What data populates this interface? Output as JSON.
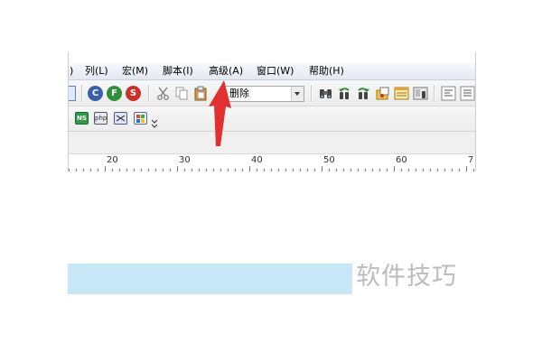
{
  "menubar": {
    "items": [
      {
        "label": ")"
      },
      {
        "label": "列(L)"
      },
      {
        "label": "宏(M)"
      },
      {
        "label": "脚本(I)"
      },
      {
        "label": "高级(A)"
      },
      {
        "label": "窗口(W)"
      },
      {
        "label": "帮助(H)"
      }
    ]
  },
  "toolbar": {
    "round_buttons": [
      {
        "letter": "C",
        "color": "#3a5fa8"
      },
      {
        "letter": "F",
        "color": "#2f8f3a"
      },
      {
        "letter": "S",
        "color": "#c8322a"
      }
    ],
    "combo_value": "删除"
  },
  "toolbar2": {
    "php_label": "php",
    "ns_label": "NS"
  },
  "ruler": {
    "labels": [
      "20",
      "30",
      "40",
      "50",
      "60",
      "7"
    ]
  },
  "watermark": "软件技巧",
  "colors": {
    "highlight": "#c7e7f7",
    "annotation_arrow": "#e23030"
  }
}
